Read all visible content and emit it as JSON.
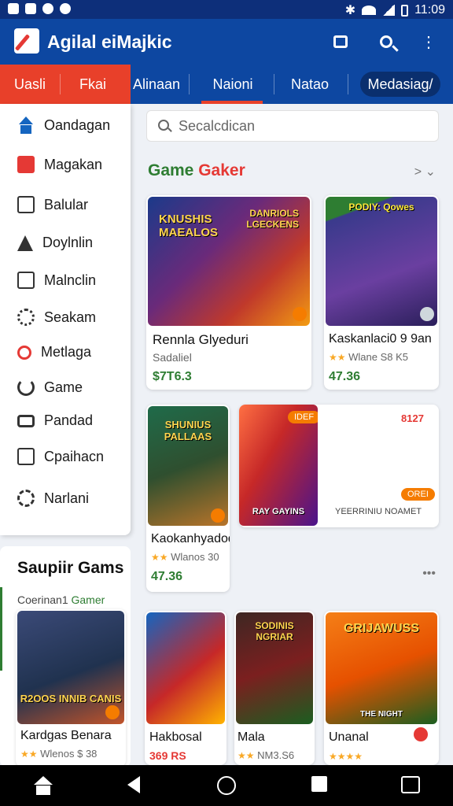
{
  "status_bar": {
    "time": "11:09"
  },
  "app_bar": {
    "title": "Agilal eiMajkic",
    "icons": [
      "chat-icon",
      "search-icon",
      "more-vert-icon"
    ]
  },
  "tabs": [
    {
      "label": "Uasli"
    },
    {
      "label": "Fkai"
    },
    {
      "label": "Alinaan"
    },
    {
      "label": "Naioni"
    },
    {
      "label": "Natao"
    },
    {
      "label": "Medasiag/"
    }
  ],
  "sidebar": {
    "items": [
      {
        "label": "Oandagan",
        "icon": "home-icon"
      },
      {
        "label": "Magakan",
        "icon": "gift-icon"
      },
      {
        "label": "Balular",
        "icon": "edit-icon"
      },
      {
        "label": "Doylnlin",
        "icon": "warning-icon"
      },
      {
        "label": "Malnclin",
        "icon": "mail-icon"
      },
      {
        "label": "Seakam",
        "icon": "settings-icon"
      },
      {
        "label": "Metlaga",
        "icon": "search-icon"
      },
      {
        "label": "Game",
        "icon": "refresh-icon"
      },
      {
        "label": "Pandad",
        "icon": "card-icon"
      },
      {
        "label": "Cpaihacn",
        "icon": "puzzle-icon"
      },
      {
        "label": "Narlani",
        "icon": "star-icon"
      }
    ]
  },
  "side_box": {
    "title": "Saupiir Gams",
    "subtitle_prefix": "Coerinan1",
    "subtitle_accent": "Gamer",
    "card": {
      "art_text": "R2OOS INNIB CANIS",
      "title": "Kardgas Benara",
      "meta": "Wlenos $ 38"
    }
  },
  "search": {
    "placeholder": "Secalcdican"
  },
  "section": {
    "title_green": "Game",
    "title_red": "Gaker"
  },
  "cards": [
    {
      "art_text_left": "KNUSHIS MAEALOS",
      "art_text_right": "DANRIOLS LGECKENS",
      "title": "Rennla Glyeduri",
      "sub": "Sadaliel",
      "price": "$7T6.3"
    },
    {
      "art_text": "PODIY: Qowes",
      "title": "Kaskanlaci0 9 9an",
      "meta": "Wlane S8 K5",
      "price": "47.36"
    },
    {
      "art_text": "SHUNIUS PALLAAS",
      "title": "Kaokanhyadoda",
      "meta": "Wlanos 30",
      "price": "47.36"
    },
    {
      "art_text": "RAY GAYINS",
      "tag": "IDEF",
      "label2": "YEERRINIU NOAMET",
      "num": "8127",
      "tag2": "OREI"
    },
    {
      "art_text": "",
      "title": "Hakbosal",
      "price": "369 RS"
    },
    {
      "art_text": "SODINIS NGRIAR",
      "title": "Mala",
      "meta": "NM3.S6"
    },
    {
      "art_text": "GRIJAWUSS",
      "art_text2": "THE NIGHT",
      "title": "Unanal",
      "stars": "★★★★"
    }
  ],
  "colors": {
    "primary": "#0d47a1",
    "accent_red": "#e8402a",
    "green": "#2e7d32"
  }
}
